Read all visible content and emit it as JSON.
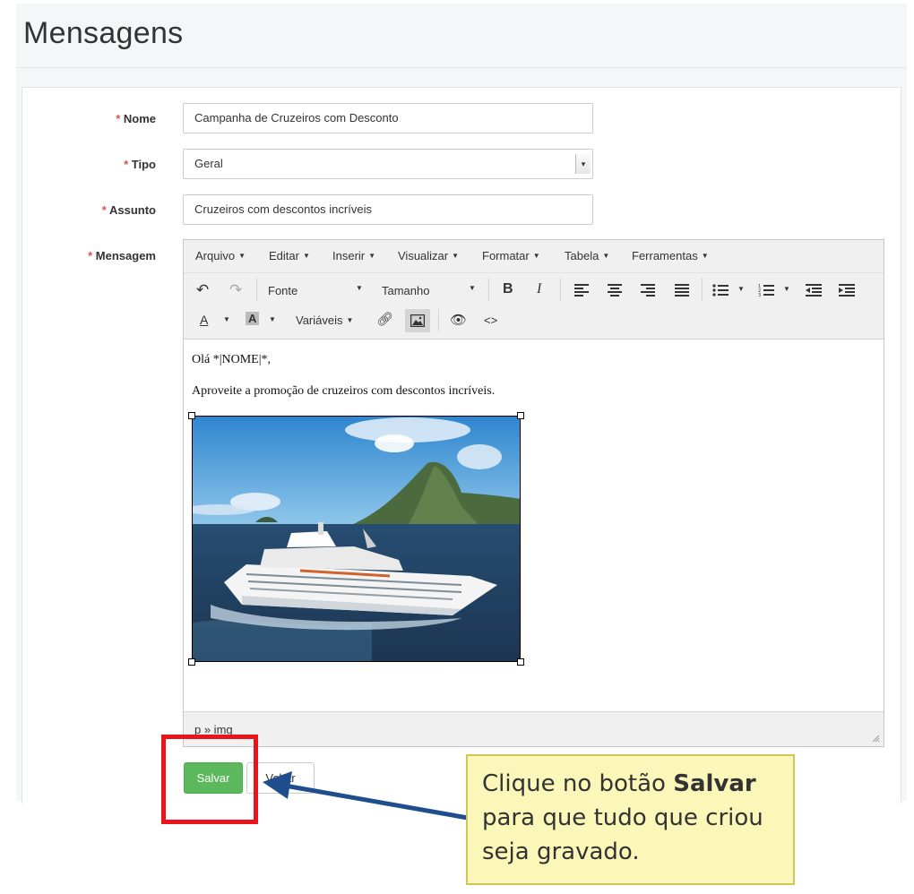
{
  "page": {
    "title": "Mensagens"
  },
  "form": {
    "required_mark": "*",
    "nome": {
      "label": "Nome",
      "value": "Campanha de Cruzeiros com Desconto"
    },
    "tipo": {
      "label": "Tipo",
      "value": "Geral"
    },
    "assunto": {
      "label": "Assunto",
      "value": "Cruzeiros com descontos incríveis"
    },
    "mensagem": {
      "label": "Mensagem"
    }
  },
  "editor": {
    "menus": [
      "Arquivo",
      "Editar",
      "Inserir",
      "Visualizar",
      "Formatar",
      "Tabela",
      "Ferramentas"
    ],
    "toolbar": {
      "font_label": "Fonte",
      "size_label": "Tamanho",
      "bold": "B",
      "italic": "I",
      "text_color": "A",
      "bg_color": "A",
      "variables_label": "Variáveis",
      "source_code": "<>"
    },
    "content": {
      "line1": "Olá *|NOME|*,",
      "line2": "Aproveite a promoção de cruzeiros com descontos incríveis."
    },
    "path": "p » img"
  },
  "buttons": {
    "save": "Salvar",
    "back": "Voltar"
  },
  "callout": {
    "text_before": "Clique no botão ",
    "text_bold": "Salvar",
    "text_after": " para que tudo que criou seja gravado."
  },
  "colors": {
    "save_green": "#5cb85c",
    "highlight_red": "#e8161b",
    "arrow_blue": "#1f4e8c",
    "callout_bg": "#fbf7b8",
    "required_red": "#d9534f"
  },
  "icons": [
    "undo-icon",
    "redo-icon",
    "align-left-icon",
    "align-center-icon",
    "align-right-icon",
    "align-justify-icon",
    "bullet-list-icon",
    "numbered-list-icon",
    "outdent-icon",
    "indent-icon",
    "link-icon",
    "image-icon",
    "preview-eye-icon",
    "resize-handle-icon",
    "dropdown-caret-icon"
  ]
}
